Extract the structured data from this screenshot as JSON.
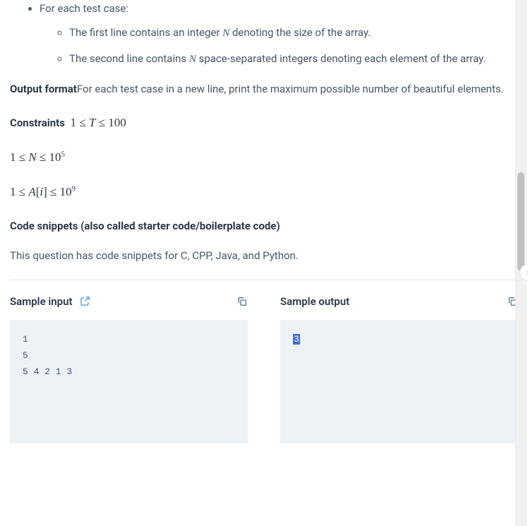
{
  "input_format": {
    "item1": "For each test case:",
    "sub1_prefix": "The first line contains an integer ",
    "sub1_var": "N",
    "sub1_suffix": " denoting the size of the array.",
    "sub2_prefix": "The second line contains ",
    "sub2_var": "N",
    "sub2_suffix": " space-separated integers denoting each element of the array."
  },
  "output_format": {
    "heading": "Output format",
    "text": "For each test case in a new line, print the maximum possible number of beautiful elements."
  },
  "constraints": {
    "heading": "Constraints",
    "c1": "1 ≤ T ≤ 100",
    "c2_html": "1 ≤ N ≤ 10^5",
    "c3_html": "1 ≤ A[i] ≤ 10^9"
  },
  "snippets": {
    "heading": "Code snippets (also called starter code/boilerplate code)",
    "text": "This question has code snippets for C, CPP, Java, and Python."
  },
  "samples": {
    "input_label": "Sample input",
    "output_label": "Sample output",
    "input_data": "1\n5\n5 4 2 1 3",
    "output_data": "3"
  }
}
